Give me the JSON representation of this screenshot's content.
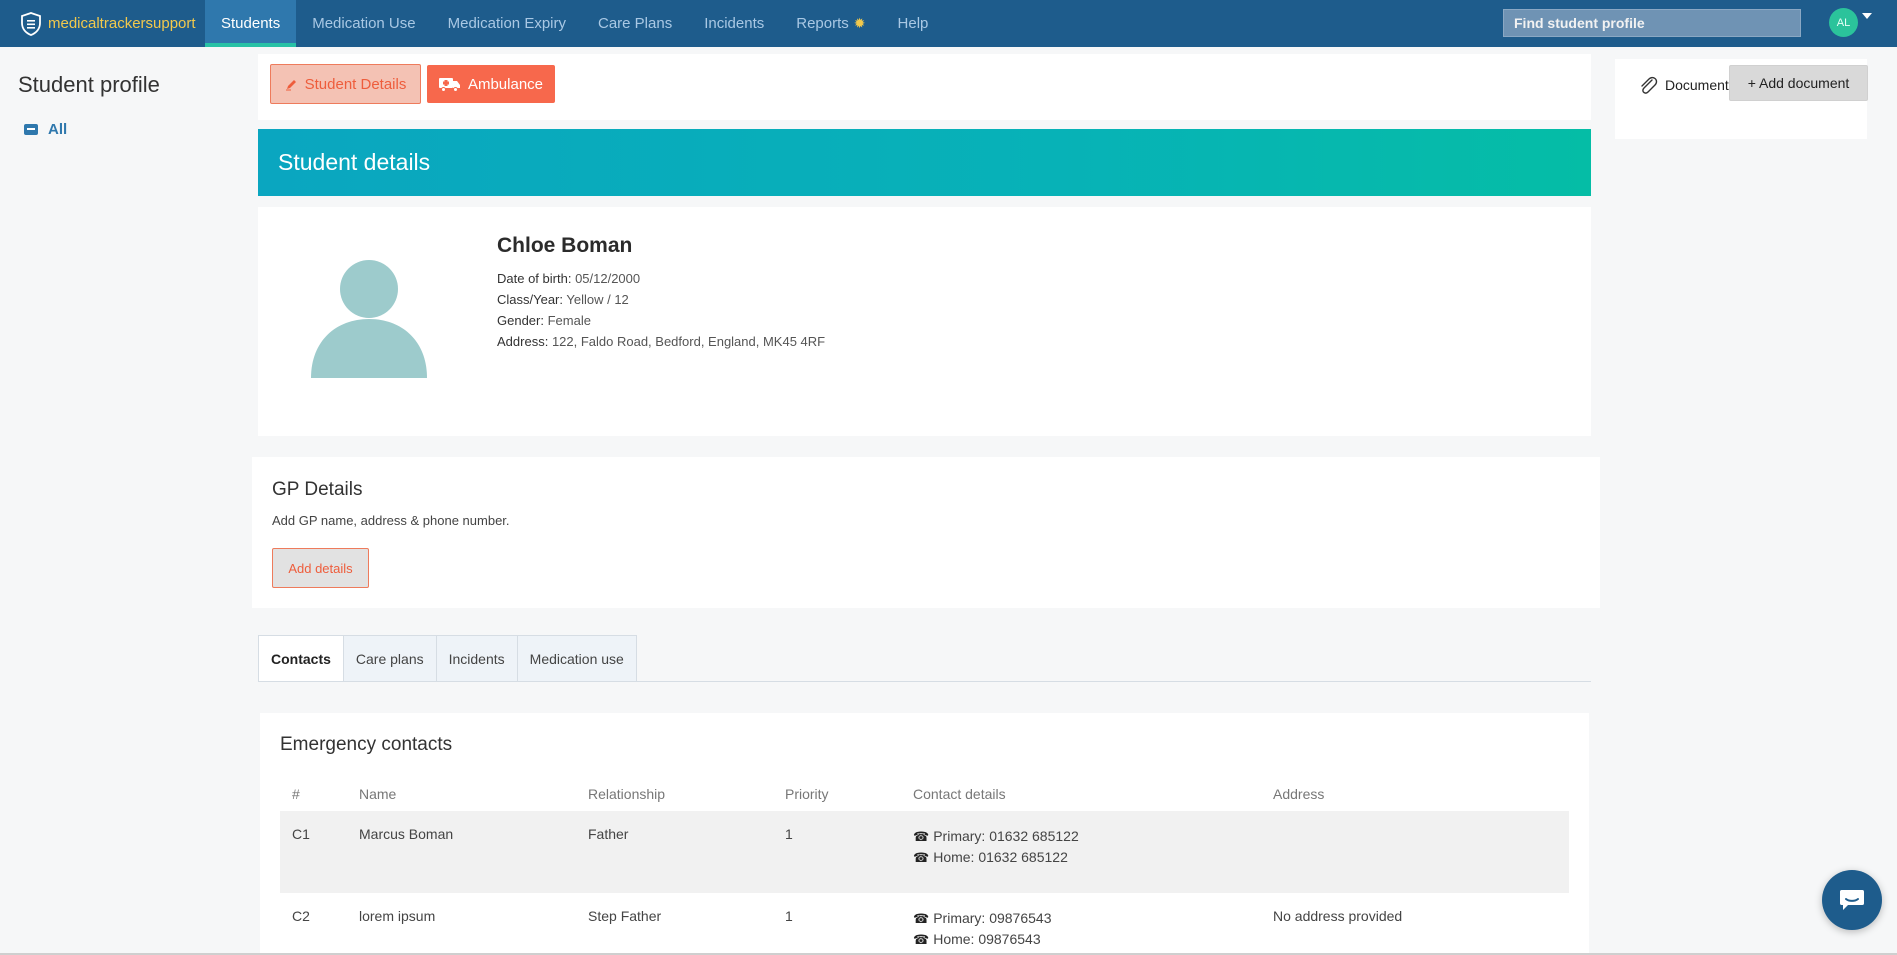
{
  "nav": {
    "brand": "medicaltrackersupport",
    "items": [
      {
        "label": "Students",
        "active": true
      },
      {
        "label": "Medication Use"
      },
      {
        "label": "Medication Expiry"
      },
      {
        "label": "Care Plans"
      },
      {
        "label": "Incidents"
      },
      {
        "label": "Reports"
      },
      {
        "label": "Help"
      }
    ],
    "search_placeholder": "Find student profile",
    "avatar_initials": "AL"
  },
  "sidebar": {
    "title": "Student profile",
    "items": [
      {
        "label": "All"
      }
    ]
  },
  "actions": {
    "student_details_label": "Student Details",
    "ambulance_label": "Ambulance"
  },
  "student": {
    "banner_title": "Student details",
    "name": "Chloe Boman",
    "fields": [
      {
        "label": "Date of birth:",
        "value": "05/12/2000"
      },
      {
        "label": "Class/Year:",
        "value": "Yellow / 12"
      },
      {
        "label": "Gender:",
        "value": "Female"
      },
      {
        "label": "Address:",
        "value": "122, Faldo Road, Bedford, England, MK45 4RF"
      }
    ]
  },
  "gp": {
    "title": "GP Details",
    "description": "Add GP name, address & phone number.",
    "add_label": "Add details"
  },
  "tabs": [
    {
      "label": "Contacts",
      "active": true
    },
    {
      "label": "Care plans"
    },
    {
      "label": "Incidents"
    },
    {
      "label": "Medication use"
    }
  ],
  "contacts": {
    "title": "Emergency contacts",
    "columns": [
      "#",
      "Name",
      "Relationship",
      "Priority",
      "Contact details",
      "Address"
    ],
    "rows": [
      {
        "id": "C1",
        "name": "Marcus Boman",
        "relationship": "Father",
        "priority": "1",
        "primary": "Primary: 01632 685122",
        "home": "Home: 01632 685122",
        "address": ""
      },
      {
        "id": "C2",
        "name": "lorem ipsum",
        "relationship": "Step Father",
        "priority": "1",
        "primary": "Primary: 09876543",
        "home": "Home: 09876543",
        "address": "No address provided"
      }
    ]
  },
  "documents": {
    "label": "Documents",
    "add_label": "+ Add document"
  },
  "colors": {
    "navbar": "#1e5c8c",
    "accent_orange": "#f7684c",
    "banner_teal": "#07b2b7",
    "avatar_green": "#2bc39b"
  }
}
